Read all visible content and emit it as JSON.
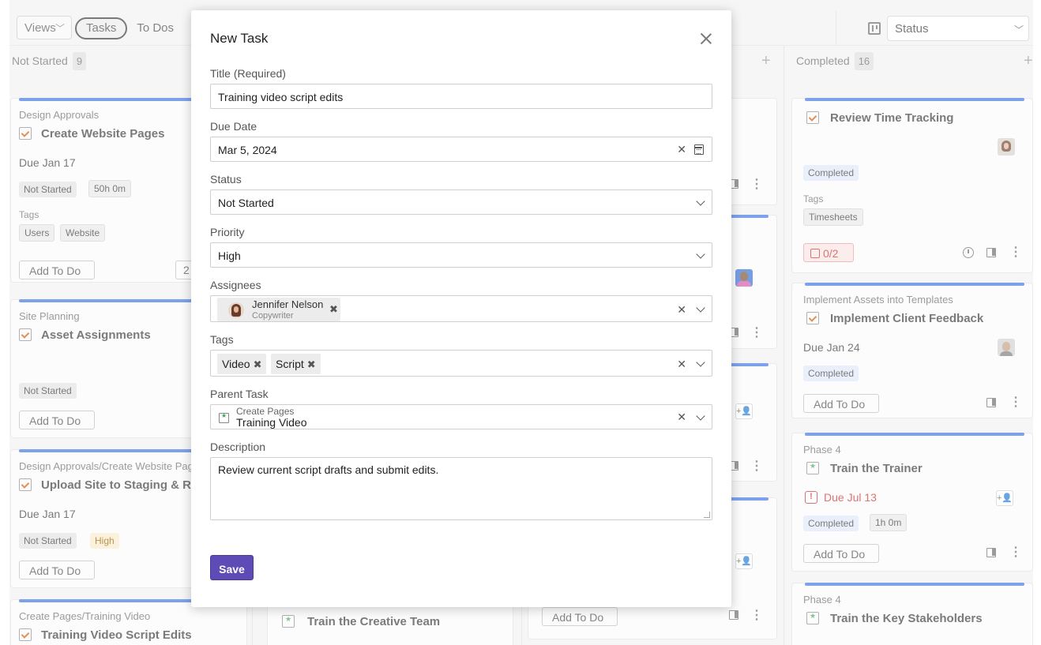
{
  "toolbar": {
    "views_label": "Views",
    "tabs": [
      "Tasks",
      "To Dos"
    ],
    "status_select": "Status"
  },
  "columns": [
    {
      "name": "Not Started",
      "count": "9"
    },
    {
      "name": "Completed",
      "count": "16"
    }
  ],
  "left_cards": [
    {
      "project": "Design Approvals",
      "title": "Create Website Pages",
      "due": "Due Jan 17",
      "status": "Not Started",
      "time": "50h 0m",
      "tags_label": "Tags",
      "tags": [
        "Users",
        "Website"
      ],
      "add_todo": "Add To Do",
      "counter": "2"
    },
    {
      "project": "Site Planning",
      "title": "Asset Assignments",
      "status": "Not Started",
      "add_todo": "Add To Do"
    },
    {
      "project": "Design Approvals/Create Website Pages",
      "title": "Upload Site to Staging & Rou",
      "due": "Due Jan 17",
      "status": "Not Started",
      "priority": "High",
      "add_todo": "Add To Do"
    },
    {
      "project": "Create Pages/Training Video",
      "title": "Training Video Script Edits"
    }
  ],
  "middle_cards": {
    "train_creative": "Train the Creative Team",
    "add_todo": "Add To Do"
  },
  "right_cards": [
    {
      "title": "Review Time Tracking",
      "status": "Completed",
      "tags_label": "Tags",
      "tags": [
        "Timesheets"
      ],
      "todo_count": "0/2"
    },
    {
      "project": "Implement Assets into Templates",
      "title": "Implement Client Feedback",
      "due": "Due Jan 24",
      "status": "Completed",
      "add_todo": "Add To Do"
    },
    {
      "project": "Phase 4",
      "title": "Train the Trainer",
      "due": "Due Jul 13",
      "status": "Completed",
      "time": "1h 0m",
      "add_todo": "Add To Do"
    },
    {
      "project": "Phase 4",
      "title": "Train the Key Stakeholders"
    }
  ],
  "modal": {
    "title": "New Task",
    "title_label": "Title (Required)",
    "title_value": "Training video script edits",
    "due_label": "Due Date",
    "due_value": "Mar 5, 2024",
    "status_label": "Status",
    "status_value": "Not Started",
    "priority_label": "Priority",
    "priority_value": "High",
    "assignees_label": "Assignees",
    "assignee_name": "Jennifer Nelson",
    "assignee_role": "Copywriter",
    "tags_label": "Tags",
    "tags": [
      "Video",
      "Script"
    ],
    "parent_label": "Parent Task",
    "parent_project": "Create Pages",
    "parent_value": "Training Video",
    "description_label": "Description",
    "description_value": "Review current script drafts and submit edits.",
    "save_label": "Save"
  },
  "colors": {
    "accent": "#5e4bb5",
    "progress_bar": "#3a6fe0",
    "danger": "#c62828"
  }
}
